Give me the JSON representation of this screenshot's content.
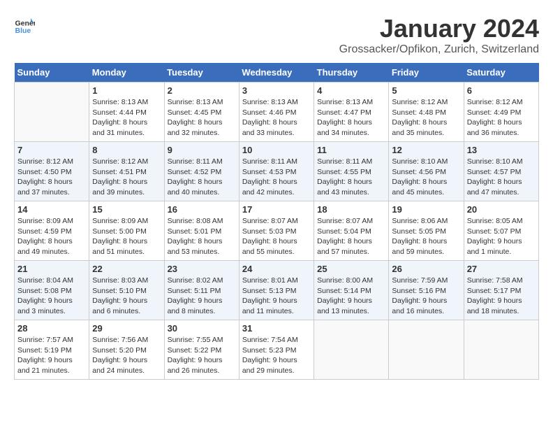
{
  "logo": {
    "text_general": "General",
    "text_blue": "Blue"
  },
  "title": "January 2024",
  "subtitle": "Grossacker/Opfikon, Zurich, Switzerland",
  "headers": [
    "Sunday",
    "Monday",
    "Tuesday",
    "Wednesday",
    "Thursday",
    "Friday",
    "Saturday"
  ],
  "weeks": [
    [
      {
        "day": "",
        "sunrise": "",
        "sunset": "",
        "daylight": ""
      },
      {
        "day": "1",
        "sunrise": "Sunrise: 8:13 AM",
        "sunset": "Sunset: 4:44 PM",
        "daylight": "Daylight: 8 hours and 31 minutes."
      },
      {
        "day": "2",
        "sunrise": "Sunrise: 8:13 AM",
        "sunset": "Sunset: 4:45 PM",
        "daylight": "Daylight: 8 hours and 32 minutes."
      },
      {
        "day": "3",
        "sunrise": "Sunrise: 8:13 AM",
        "sunset": "Sunset: 4:46 PM",
        "daylight": "Daylight: 8 hours and 33 minutes."
      },
      {
        "day": "4",
        "sunrise": "Sunrise: 8:13 AM",
        "sunset": "Sunset: 4:47 PM",
        "daylight": "Daylight: 8 hours and 34 minutes."
      },
      {
        "day": "5",
        "sunrise": "Sunrise: 8:12 AM",
        "sunset": "Sunset: 4:48 PM",
        "daylight": "Daylight: 8 hours and 35 minutes."
      },
      {
        "day": "6",
        "sunrise": "Sunrise: 8:12 AM",
        "sunset": "Sunset: 4:49 PM",
        "daylight": "Daylight: 8 hours and 36 minutes."
      }
    ],
    [
      {
        "day": "7",
        "sunrise": "Sunrise: 8:12 AM",
        "sunset": "Sunset: 4:50 PM",
        "daylight": "Daylight: 8 hours and 37 minutes."
      },
      {
        "day": "8",
        "sunrise": "Sunrise: 8:12 AM",
        "sunset": "Sunset: 4:51 PM",
        "daylight": "Daylight: 8 hours and 39 minutes."
      },
      {
        "day": "9",
        "sunrise": "Sunrise: 8:11 AM",
        "sunset": "Sunset: 4:52 PM",
        "daylight": "Daylight: 8 hours and 40 minutes."
      },
      {
        "day": "10",
        "sunrise": "Sunrise: 8:11 AM",
        "sunset": "Sunset: 4:53 PM",
        "daylight": "Daylight: 8 hours and 42 minutes."
      },
      {
        "day": "11",
        "sunrise": "Sunrise: 8:11 AM",
        "sunset": "Sunset: 4:55 PM",
        "daylight": "Daylight: 8 hours and 43 minutes."
      },
      {
        "day": "12",
        "sunrise": "Sunrise: 8:10 AM",
        "sunset": "Sunset: 4:56 PM",
        "daylight": "Daylight: 8 hours and 45 minutes."
      },
      {
        "day": "13",
        "sunrise": "Sunrise: 8:10 AM",
        "sunset": "Sunset: 4:57 PM",
        "daylight": "Daylight: 8 hours and 47 minutes."
      }
    ],
    [
      {
        "day": "14",
        "sunrise": "Sunrise: 8:09 AM",
        "sunset": "Sunset: 4:59 PM",
        "daylight": "Daylight: 8 hours and 49 minutes."
      },
      {
        "day": "15",
        "sunrise": "Sunrise: 8:09 AM",
        "sunset": "Sunset: 5:00 PM",
        "daylight": "Daylight: 8 hours and 51 minutes."
      },
      {
        "day": "16",
        "sunrise": "Sunrise: 8:08 AM",
        "sunset": "Sunset: 5:01 PM",
        "daylight": "Daylight: 8 hours and 53 minutes."
      },
      {
        "day": "17",
        "sunrise": "Sunrise: 8:07 AM",
        "sunset": "Sunset: 5:03 PM",
        "daylight": "Daylight: 8 hours and 55 minutes."
      },
      {
        "day": "18",
        "sunrise": "Sunrise: 8:07 AM",
        "sunset": "Sunset: 5:04 PM",
        "daylight": "Daylight: 8 hours and 57 minutes."
      },
      {
        "day": "19",
        "sunrise": "Sunrise: 8:06 AM",
        "sunset": "Sunset: 5:05 PM",
        "daylight": "Daylight: 8 hours and 59 minutes."
      },
      {
        "day": "20",
        "sunrise": "Sunrise: 8:05 AM",
        "sunset": "Sunset: 5:07 PM",
        "daylight": "Daylight: 9 hours and 1 minute."
      }
    ],
    [
      {
        "day": "21",
        "sunrise": "Sunrise: 8:04 AM",
        "sunset": "Sunset: 5:08 PM",
        "daylight": "Daylight: 9 hours and 3 minutes."
      },
      {
        "day": "22",
        "sunrise": "Sunrise: 8:03 AM",
        "sunset": "Sunset: 5:10 PM",
        "daylight": "Daylight: 9 hours and 6 minutes."
      },
      {
        "day": "23",
        "sunrise": "Sunrise: 8:02 AM",
        "sunset": "Sunset: 5:11 PM",
        "daylight": "Daylight: 9 hours and 8 minutes."
      },
      {
        "day": "24",
        "sunrise": "Sunrise: 8:01 AM",
        "sunset": "Sunset: 5:13 PM",
        "daylight": "Daylight: 9 hours and 11 minutes."
      },
      {
        "day": "25",
        "sunrise": "Sunrise: 8:00 AM",
        "sunset": "Sunset: 5:14 PM",
        "daylight": "Daylight: 9 hours and 13 minutes."
      },
      {
        "day": "26",
        "sunrise": "Sunrise: 7:59 AM",
        "sunset": "Sunset: 5:16 PM",
        "daylight": "Daylight: 9 hours and 16 minutes."
      },
      {
        "day": "27",
        "sunrise": "Sunrise: 7:58 AM",
        "sunset": "Sunset: 5:17 PM",
        "daylight": "Daylight: 9 hours and 18 minutes."
      }
    ],
    [
      {
        "day": "28",
        "sunrise": "Sunrise: 7:57 AM",
        "sunset": "Sunset: 5:19 PM",
        "daylight": "Daylight: 9 hours and 21 minutes."
      },
      {
        "day": "29",
        "sunrise": "Sunrise: 7:56 AM",
        "sunset": "Sunset: 5:20 PM",
        "daylight": "Daylight: 9 hours and 24 minutes."
      },
      {
        "day": "30",
        "sunrise": "Sunrise: 7:55 AM",
        "sunset": "Sunset: 5:22 PM",
        "daylight": "Daylight: 9 hours and 26 minutes."
      },
      {
        "day": "31",
        "sunrise": "Sunrise: 7:54 AM",
        "sunset": "Sunset: 5:23 PM",
        "daylight": "Daylight: 9 hours and 29 minutes."
      },
      {
        "day": "",
        "sunrise": "",
        "sunset": "",
        "daylight": ""
      },
      {
        "day": "",
        "sunrise": "",
        "sunset": "",
        "daylight": ""
      },
      {
        "day": "",
        "sunrise": "",
        "sunset": "",
        "daylight": ""
      }
    ]
  ]
}
